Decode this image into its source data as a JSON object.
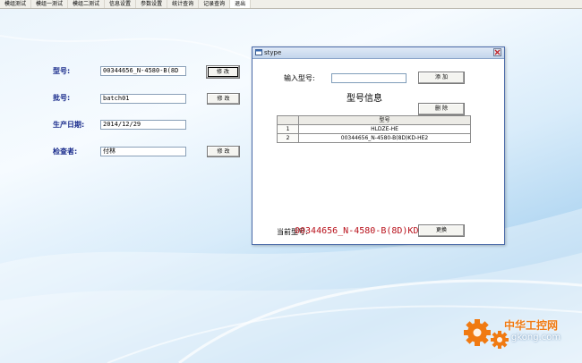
{
  "menu": {
    "items": [
      "模组测试",
      "模组一测试",
      "模组二测试",
      "信息设置",
      "参数设置",
      "统计查询",
      "记录查询",
      "退出"
    ]
  },
  "form": {
    "model_label": "型号:",
    "model_value": "00344656_N-4580-B(8D",
    "batch_label": "批号:",
    "batch_value": "batch01",
    "date_label": "生产日期:",
    "date_value": "2014/12/29",
    "inspector_label": "检查者:",
    "inspector_value": "付林",
    "edit_button_label": "修 改"
  },
  "dialog": {
    "title": "stype",
    "input_label": "输入型号:",
    "input_value": "",
    "add_button": "添 加",
    "section_title": "型号信息",
    "delete_button": "删 除",
    "table": {
      "header": "型号",
      "rows": [
        {
          "index": "1",
          "model": "HLDZE-HE"
        },
        {
          "index": "2",
          "model": "00344656_N-4580-B(8D)KD-HE2"
        }
      ]
    },
    "current_label": "当前型号:",
    "current_value": "00344656_N-4580-B(8D)KD",
    "change_button": "更换"
  },
  "watermark": {
    "cn_text": "中华工控网",
    "en_text": "gkong.com"
  },
  "colors": {
    "label_blue": "#1a2c8c",
    "current_value_red": "#b8101a",
    "watermark_orange": "#f07a12"
  }
}
